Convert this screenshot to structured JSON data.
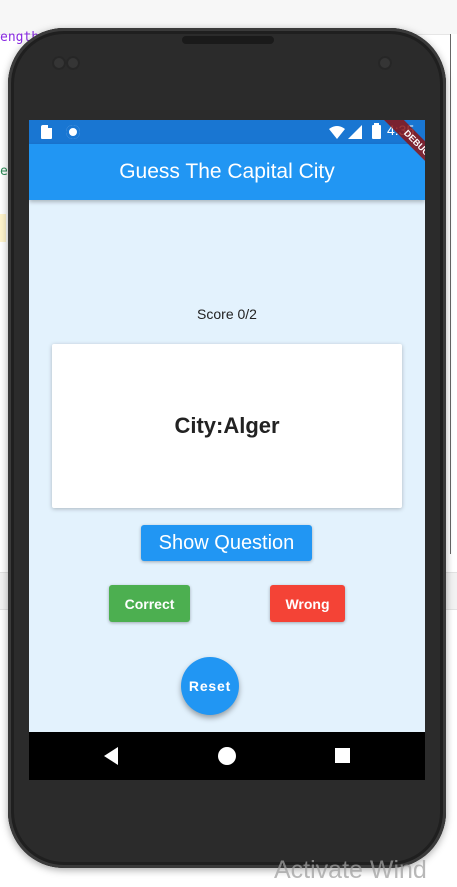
{
  "ide": {
    "code_fragment": "ength",
    "code_fragment_2": "e"
  },
  "statusbar": {
    "time": "4:35",
    "debug_banner": "DEBUG",
    "icons": [
      "sd-card-icon",
      "circle-icon",
      "wifi-icon",
      "signal-icon",
      "battery-icon"
    ]
  },
  "appbar": {
    "title": "Guess The Capital City",
    "color": "#2196f3"
  },
  "quiz": {
    "score": "Score 0/2",
    "card_text": "City:Alger",
    "show_question_label": "Show Question",
    "correct_label": "Correct",
    "wrong_label": "Wrong",
    "reset_label": "Reset"
  },
  "colors": {
    "background": "#e3f2fd",
    "primary": "#2196f3",
    "correct": "#4caf50",
    "wrong": "#f44336"
  },
  "nav": {
    "icons": [
      "back-icon",
      "home-icon",
      "recents-icon"
    ]
  },
  "watermark": "Activate Wind"
}
